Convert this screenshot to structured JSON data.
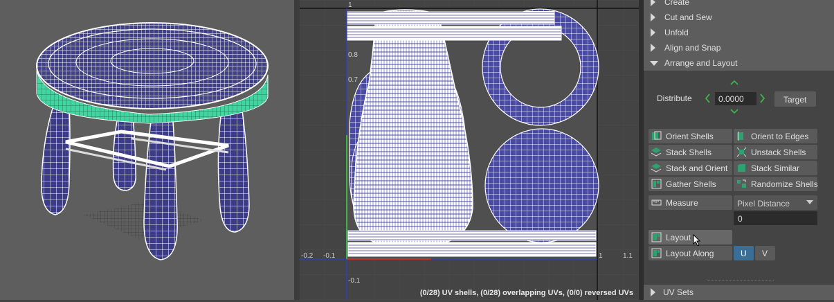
{
  "uv_editor": {
    "axis_labels": {
      "y_1": "1",
      "y_08": "0.8",
      "y_07": "0.7",
      "y_neg01": "-0.1",
      "x_neg02": "-0.2",
      "x_neg01": "-0.1",
      "x_1": "1",
      "x_11": "1.1"
    },
    "status": "(0/28) UV shells, (0/28) overlapping UVs, (0/0) reversed UVs"
  },
  "panel": {
    "sections": {
      "create": "Create",
      "cut_and_sew": "Cut and Sew",
      "unfold": "Unfold",
      "align_and_snap": "Align and Snap",
      "arrange_and_layout": "Arrange and Layout",
      "uv_sets": "UV Sets"
    },
    "distribute": {
      "label": "Distribute",
      "value": "0.0000",
      "target_label": "Target"
    },
    "buttons": {
      "orient_shells": "Orient Shells",
      "orient_to_edges": "Orient to Edges",
      "stack_shells": "Stack Shells",
      "unstack_shells": "Unstack Shells",
      "stack_and_orient": "Stack and Orient",
      "stack_similar": "Stack Similar",
      "gather_shells": "Gather Shells",
      "randomize_shells": "Randomize Shells",
      "measure": "Measure",
      "layout": "Layout",
      "layout_along": "Layout Along"
    },
    "measure_dropdown": "Pixel Distance",
    "measure_value": "0",
    "layout_along": {
      "u": "U",
      "v": "V"
    }
  },
  "colors": {
    "accent_blue": "#3b6e96",
    "uv_blue": "#4a4aa0",
    "selection_green": "#3fd6a0",
    "arrow_green": "#3fb24a"
  }
}
